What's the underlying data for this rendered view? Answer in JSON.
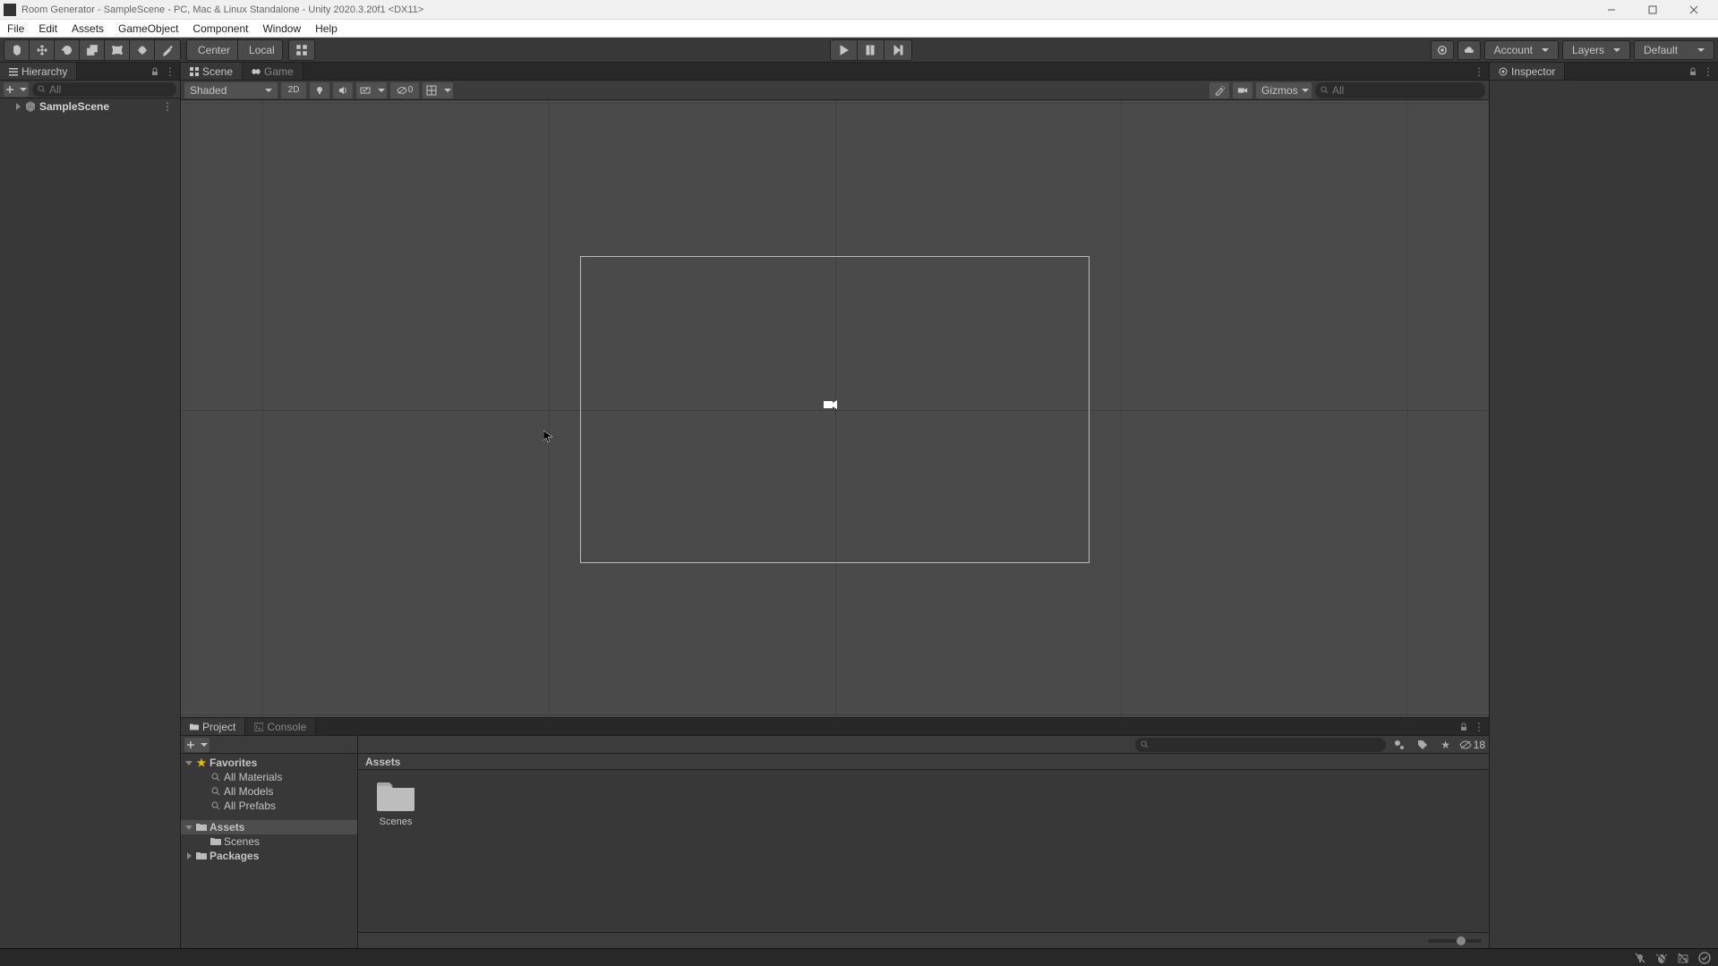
{
  "window_title": "Room Generator - SampleScene - PC, Mac & Linux Standalone - Unity 2020.3.20f1 <DX11>",
  "menu": [
    "File",
    "Edit",
    "Assets",
    "GameObject",
    "Component",
    "Window",
    "Help"
  ],
  "toolbar": {
    "pivot": "Center",
    "handle": "Local",
    "account": "Account",
    "layers": "Layers",
    "layout": "Default"
  },
  "hierarchy": {
    "tab": "Hierarchy",
    "search_placeholder": "All",
    "scene": "SampleScene"
  },
  "scene": {
    "tabs": {
      "scene": "Scene",
      "game": "Game"
    },
    "draw_mode": "Shaded",
    "mode2d": "2D",
    "gizmos": "Gizmos",
    "search_placeholder": "All",
    "layers_count": "0"
  },
  "inspector": {
    "tab": "Inspector"
  },
  "project": {
    "tabs": {
      "project": "Project",
      "console": "Console"
    },
    "tree": {
      "favorites": "Favorites",
      "all_materials": "All Materials",
      "all_models": "All Models",
      "all_prefabs": "All Prefabs",
      "assets": "Assets",
      "scenes": "Scenes",
      "packages": "Packages"
    },
    "breadcrumb": "Assets",
    "items": [
      {
        "label": "Scenes"
      }
    ],
    "hidden_count": "18"
  }
}
